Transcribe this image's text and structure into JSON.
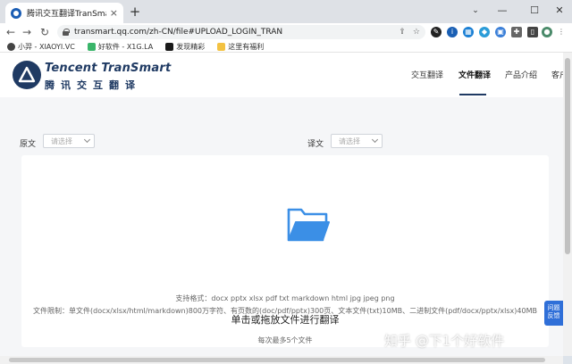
{
  "browser": {
    "tab_title": "腾讯交互翻译TranSmart",
    "tab_close": "×",
    "new_tab": "+",
    "url": "transmart.qq.com/zh-CN/file#UPLOAD_LOGIN_TRAN",
    "bookmarks": [
      {
        "label": "小羿 - XIAOYI.VC",
        "color": "#444444"
      },
      {
        "label": "好软件 - X1G.LA",
        "color": "#3ab56a"
      },
      {
        "label": "发现精彩",
        "color": "#1a1a1a"
      },
      {
        "label": "这里有福利",
        "color": "#f3c242"
      }
    ]
  },
  "header": {
    "logo_en": "Tencent TranSmart",
    "logo_cn": "腾讯交互翻译",
    "nav": [
      "交互翻译",
      "文件翻译",
      "产品介绍",
      "客户"
    ]
  },
  "languages": {
    "source_label": "原文",
    "source_placeholder": "请选择",
    "target_label": "译文",
    "target_placeholder": "请选择"
  },
  "upload": {
    "title": "单击或拖放文件进行翻译",
    "max_files": "每次最多5个文件",
    "formats": "支持格式：docx pptx xlsx pdf txt markdown html jpg jpeg png",
    "limits": "文件限制：单文件(docx/xlsx/html/markdown)800万字符、有页数的(doc/pdf/pptx)300页、文本文件(txt)10MB、二进制文件(pdf/docx/pptx/xlsx)40MB"
  },
  "feedback": {
    "line1": "问题",
    "line2": "反馈"
  },
  "watermark": "知乎 @下1个好软件",
  "colors": {
    "brand": "#1f3a63",
    "accent": "#2f6fd8",
    "folder": "#3b8fe6"
  }
}
